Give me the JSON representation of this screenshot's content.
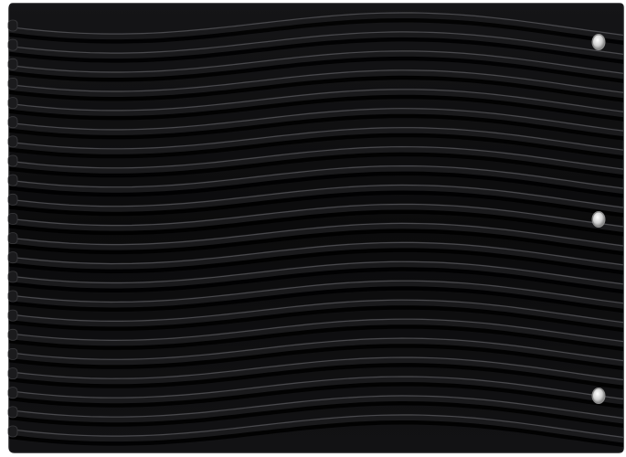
{
  "image": {
    "subject": "grill-grate",
    "colors": {
      "background": "#ffffff",
      "body": "#0b0b0c",
      "body_edge": "#1c1c1e",
      "ridge_highlight": "#5a5a5e",
      "ridge_shadow": "#000000",
      "bolt": "#d9d9d9",
      "bolt_rim": "#8a8a8a"
    },
    "ridge_count": 22,
    "bolt_count": 3
  }
}
